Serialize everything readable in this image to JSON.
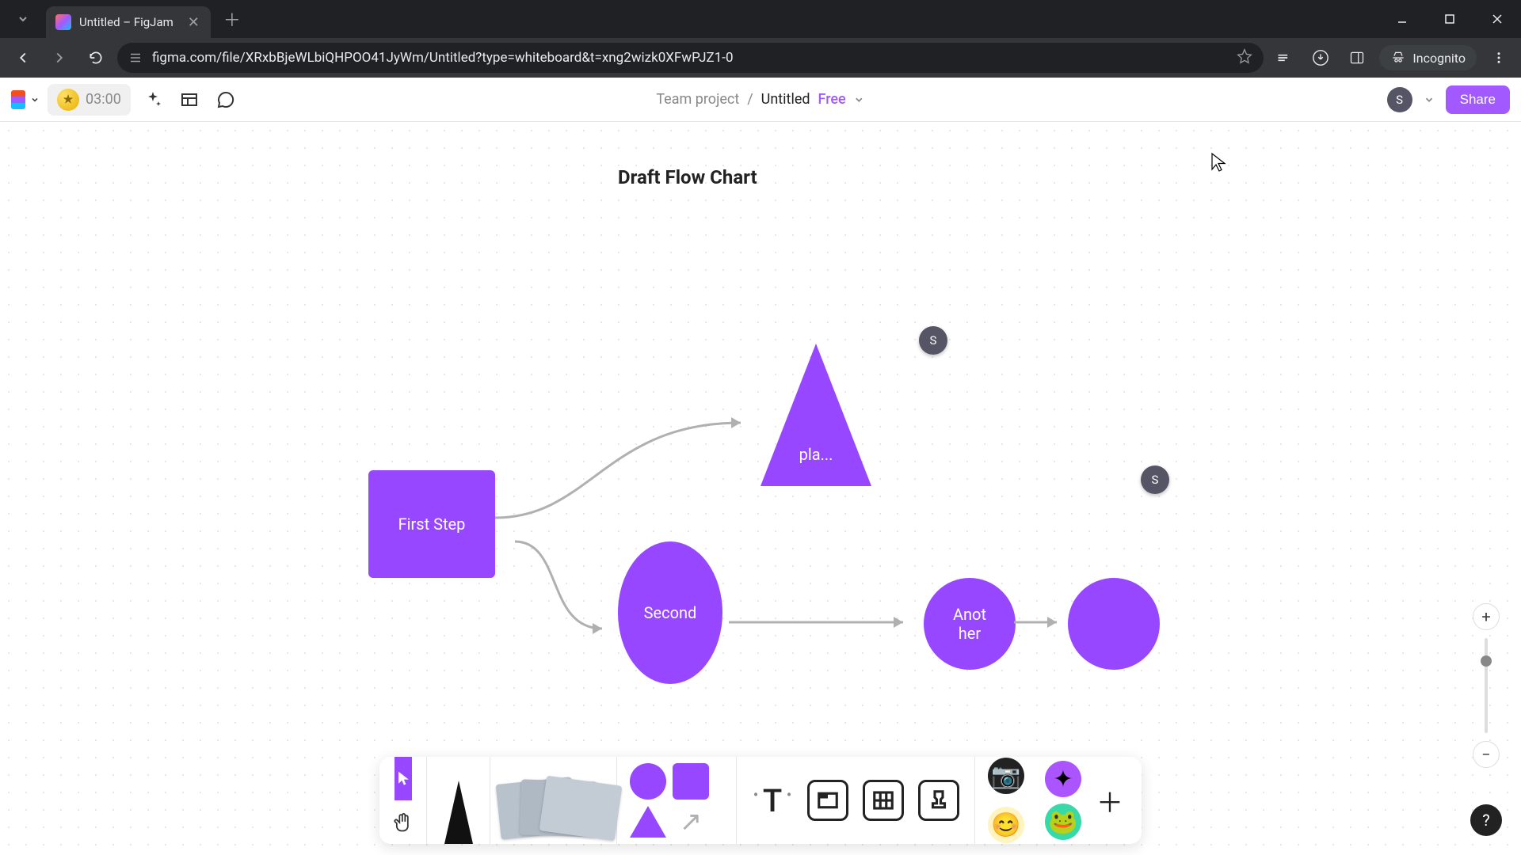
{
  "browser": {
    "tab_title": "Untitled – FigJam",
    "url": "figma.com/file/XRxbBjeWLbiQHPOO41JyWm/Untitled?type=whiteboard&t=xng2wizk0XFwPJZ1-0",
    "incognito_label": "Incognito"
  },
  "appbar": {
    "timer": "03:00",
    "team": "Team project",
    "file": "Untitled",
    "plan": "Free",
    "user_initial": "S",
    "share_label": "Share"
  },
  "canvas": {
    "title": "Draft Flow Chart",
    "shapes": {
      "rect1": "First Step",
      "triangle1": "pla...",
      "ellipse1": "Second",
      "circle1": "Anot\nher",
      "circle2": ""
    },
    "collab_initial": "S"
  },
  "zoom": {
    "plus": "+",
    "minus": "−"
  },
  "help": "?"
}
